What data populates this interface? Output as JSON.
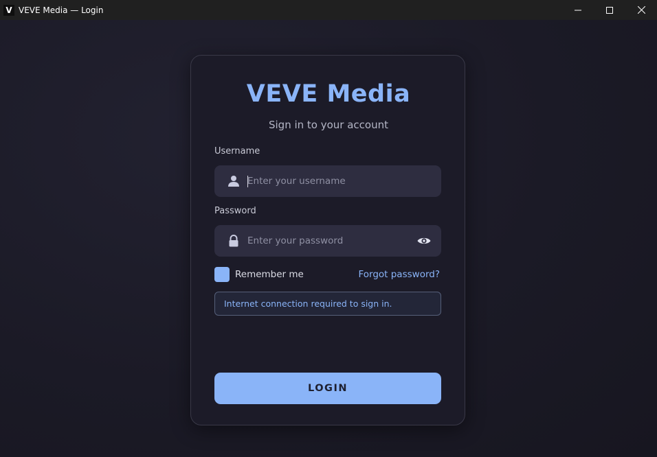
{
  "window": {
    "app_icon_letter": "V",
    "title": "VEVE Media — Login"
  },
  "brand": {
    "title": "VEVE Media",
    "subtitle": "Sign in to your account"
  },
  "form": {
    "username": {
      "label": "Username",
      "placeholder": "Enter your username",
      "value": "",
      "icon": "user-icon"
    },
    "password": {
      "label": "Password",
      "placeholder": "Enter your password",
      "value": "",
      "icon": "lock-icon",
      "toggle_icon": "eye-icon"
    },
    "remember_label": "Remember me",
    "remember_checked": false,
    "forgot_label": "Forgot password?",
    "notice": "Internet connection required to sign in.",
    "submit_label": "LOGIN"
  },
  "colors": {
    "accent": "#8ab4f8",
    "background": "#1c1b27",
    "card": "#1c1b28",
    "input": "#2e2d40"
  }
}
